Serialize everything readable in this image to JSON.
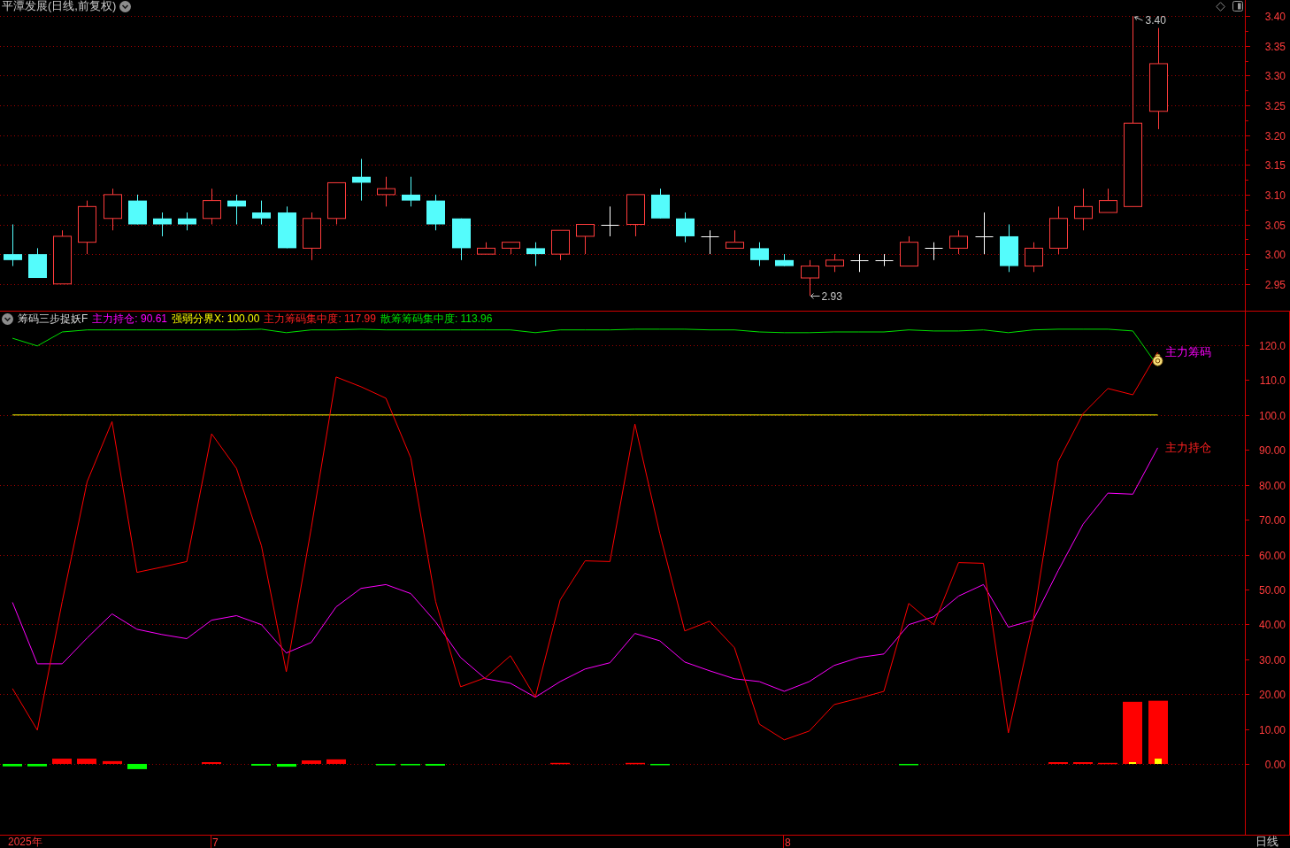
{
  "price_pane": {
    "title": "平潭发展(日线,前复权)",
    "chart_data": {
      "type": "candlestick",
      "categories": [
        null,
        null,
        null,
        null,
        null,
        null,
        null,
        null,
        null,
        null,
        null,
        null,
        null,
        null,
        null,
        null,
        null,
        null,
        null,
        null,
        null,
        null,
        null,
        null,
        null,
        null,
        null,
        null,
        null,
        null,
        null,
        null,
        null,
        null,
        null,
        null,
        null,
        null,
        null,
        null,
        null,
        null,
        null,
        null,
        null,
        null,
        null,
        null,
        null,
        null
      ],
      "ylim": [
        2.905,
        3.427
      ],
      "grid": true,
      "yticks": [
        {
          "value": 3.4,
          "label": "3.40"
        },
        {
          "value": 3.35,
          "label": "3.35"
        },
        {
          "value": 3.3,
          "label": "3.30"
        },
        {
          "value": 3.25,
          "label": "3.25"
        },
        {
          "value": 3.2,
          "label": "3.20"
        },
        {
          "value": 3.15,
          "label": "3.15"
        },
        {
          "value": 3.1,
          "label": "3.10"
        },
        {
          "value": 3.05,
          "label": "3.05"
        },
        {
          "value": 3.0,
          "label": "3.00"
        },
        {
          "value": 2.95,
          "label": "2.95"
        }
      ],
      "ohlc": [
        [
          3.0,
          3.05,
          2.98,
          2.99
        ],
        [
          3.0,
          3.01,
          2.96,
          2.96
        ],
        [
          2.95,
          3.04,
          2.95,
          3.03
        ],
        [
          3.02,
          3.09,
          3.0,
          3.08
        ],
        [
          3.06,
          3.11,
          3.04,
          3.1
        ],
        [
          3.09,
          3.1,
          3.05,
          3.05
        ],
        [
          3.06,
          3.07,
          3.03,
          3.05
        ],
        [
          3.06,
          3.07,
          3.04,
          3.05
        ],
        [
          3.06,
          3.11,
          3.05,
          3.09
        ],
        [
          3.09,
          3.1,
          3.05,
          3.08
        ],
        [
          3.07,
          3.09,
          3.05,
          3.06
        ],
        [
          3.07,
          3.08,
          3.01,
          3.01
        ],
        [
          3.01,
          3.07,
          2.99,
          3.06
        ],
        [
          3.06,
          3.12,
          3.05,
          3.12
        ],
        [
          3.13,
          3.16,
          3.09,
          3.12
        ],
        [
          3.1,
          3.13,
          3.08,
          3.11
        ],
        [
          3.1,
          3.13,
          3.08,
          3.09
        ],
        [
          3.09,
          3.1,
          3.04,
          3.05
        ],
        [
          3.06,
          3.06,
          2.99,
          3.01
        ],
        [
          3.0,
          3.02,
          3.0,
          3.01
        ],
        [
          3.01,
          3.02,
          3.0,
          3.02
        ],
        [
          3.01,
          3.02,
          2.98,
          3.0
        ],
        [
          3.0,
          3.04,
          2.99,
          3.04
        ],
        [
          3.03,
          3.05,
          3.0,
          3.05
        ],
        [
          3.05,
          3.08,
          3.03,
          3.05
        ],
        [
          3.05,
          3.1,
          3.03,
          3.1
        ],
        [
          3.1,
          3.11,
          3.06,
          3.06
        ],
        [
          3.06,
          3.07,
          3.02,
          3.03
        ],
        [
          3.03,
          3.04,
          3.0,
          3.03
        ],
        [
          3.01,
          3.04,
          3.01,
          3.02
        ],
        [
          3.01,
          3.02,
          2.98,
          2.99
        ],
        [
          2.99,
          3.0,
          2.98,
          2.98
        ],
        [
          2.96,
          2.99,
          2.93,
          2.98
        ],
        [
          2.98,
          3.0,
          2.97,
          2.99
        ],
        [
          2.99,
          3.0,
          2.97,
          2.99
        ],
        [
          2.99,
          3.0,
          2.98,
          2.99
        ],
        [
          2.98,
          3.03,
          2.98,
          3.02
        ],
        [
          3.01,
          3.02,
          2.99,
          3.01
        ],
        [
          3.01,
          3.04,
          3.0,
          3.03
        ],
        [
          3.03,
          3.07,
          3.0,
          3.03
        ],
        [
          3.03,
          3.05,
          2.97,
          2.98
        ],
        [
          2.98,
          3.02,
          2.97,
          3.01
        ],
        [
          3.01,
          3.08,
          3.0,
          3.06
        ],
        [
          3.06,
          3.11,
          3.04,
          3.08
        ],
        [
          3.07,
          3.11,
          3.07,
          3.09
        ],
        [
          3.08,
          3.4,
          3.08,
          3.22
        ],
        [
          3.24,
          3.38,
          3.21,
          3.32
        ],
        null,
        null,
        null
      ],
      "annotations": [
        "3.40",
        "2.93"
      ]
    }
  },
  "indicator_pane": {
    "title": "筹码三步捉妖F",
    "legend": [
      {
        "text": "主力持仓: 90.61",
        "color": "#ff00ff"
      },
      {
        "text": "强弱分界X: 100.00",
        "color": "#ffff00"
      },
      {
        "text": "主力筹码集中度: 117.99",
        "color": "#ff2020"
      },
      {
        "text": "散筹筹码集中度: 113.96",
        "color": "#00e000"
      }
    ],
    "line_labels": [
      {
        "text": "主力筹码",
        "color": "#ff00ff"
      },
      {
        "text": "主力持仓",
        "color": "#ff2020"
      }
    ],
    "chart_data": {
      "type": "line",
      "categories": [
        null,
        null,
        null,
        null,
        null,
        null,
        null,
        null,
        "7",
        null,
        null,
        null,
        null,
        null,
        null,
        null,
        null,
        null,
        null,
        null,
        null,
        null,
        null,
        null,
        null,
        null,
        null,
        null,
        null,
        null,
        null,
        "8",
        null,
        null,
        null,
        null,
        null,
        null,
        null,
        null,
        null,
        null,
        null,
        null,
        null,
        null,
        null,
        null,
        null,
        null
      ],
      "ylim": [
        -20.3,
        129.9
      ],
      "grid": true,
      "yticks": [
        {
          "value": 120,
          "label": "120.0"
        },
        {
          "value": 110,
          "label": "110.0"
        },
        {
          "value": 100,
          "label": "100.0"
        },
        {
          "value": 90,
          "label": "90.00"
        },
        {
          "value": 80,
          "label": "80.00"
        },
        {
          "value": 70,
          "label": "70.00"
        },
        {
          "value": 60,
          "label": "60.00"
        },
        {
          "value": 50,
          "label": "50.00"
        },
        {
          "value": 40,
          "label": "40.00"
        },
        {
          "value": 30,
          "label": "30.00"
        },
        {
          "value": 20,
          "label": "20.00"
        },
        {
          "value": 10,
          "label": "10.00"
        },
        {
          "value": 0,
          "label": "0.00"
        }
      ],
      "series": [
        {
          "type": "bar",
          "color": "#ff0000",
          "values": [
            null,
            null,
            1.5,
            1.5,
            0.8,
            null,
            null,
            null,
            0.5,
            null,
            null,
            null,
            1.0,
            1.3,
            null,
            null,
            null,
            null,
            null,
            null,
            null,
            null,
            0.3,
            null,
            null,
            0.3,
            null,
            null,
            null,
            null,
            null,
            null,
            null,
            null,
            null,
            null,
            null,
            null,
            null,
            null,
            null,
            null,
            0.5,
            0.5,
            0.3,
            17.8,
            18.1,
            null,
            null,
            null
          ]
        },
        {
          "type": "bar",
          "color": "#00ff00",
          "values": [
            -0.7,
            -0.7,
            null,
            null,
            null,
            -1.5,
            null,
            null,
            null,
            null,
            -0.5,
            -0.8,
            null,
            null,
            null,
            -0.4,
            -0.4,
            -0.5,
            null,
            null,
            null,
            null,
            null,
            null,
            null,
            null,
            -0.3,
            null,
            null,
            null,
            null,
            null,
            null,
            null,
            null,
            null,
            -0.3,
            null,
            null,
            null,
            null,
            null,
            null,
            null,
            null,
            null,
            null,
            null,
            null,
            null
          ]
        },
        {
          "type": "bar",
          "color": "#ffff00",
          "values": [
            null,
            null,
            null,
            null,
            null,
            null,
            null,
            null,
            null,
            null,
            null,
            null,
            null,
            null,
            null,
            null,
            null,
            null,
            null,
            null,
            null,
            null,
            null,
            null,
            null,
            null,
            null,
            null,
            null,
            null,
            null,
            null,
            null,
            null,
            null,
            null,
            null,
            null,
            null,
            null,
            null,
            null,
            null,
            null,
            null,
            0.5,
            1.5,
            null,
            null,
            null
          ]
        },
        {
          "type": "line",
          "color": "#ff00ff",
          "values": [
            46.3,
            28.7,
            28.7,
            36.1,
            43.0,
            38.6,
            37.1,
            35.9,
            41.2,
            42.5,
            39.9,
            31.8,
            34.8,
            45.0,
            50.3,
            51.4,
            48.8,
            40.7,
            30.5,
            24.4,
            23.1,
            19.1,
            23.6,
            27.2,
            29.0,
            37.4,
            35.3,
            29.2,
            26.7,
            24.4,
            23.6,
            20.8,
            23.6,
            28.2,
            30.5,
            31.5,
            39.9,
            42.2,
            48.1,
            51.4,
            39.2,
            41.2,
            55.4,
            68.7,
            77.6,
            77.3,
            90.6,
            null,
            null,
            null
          ]
        },
        {
          "type": "line",
          "color": "#ffff00",
          "values": [
            100,
            100,
            100,
            100,
            100,
            100,
            100,
            100,
            100,
            100,
            100,
            100,
            100,
            100,
            100,
            100,
            100,
            100,
            100,
            100,
            100,
            100,
            100,
            100,
            100,
            100,
            100,
            100,
            100,
            100,
            100,
            100,
            100,
            100,
            100,
            100,
            100,
            100,
            100,
            100,
            100,
            100,
            100,
            100,
            100,
            100,
            100,
            null,
            null,
            null
          ]
        },
        {
          "type": "line",
          "color": "#ff0000",
          "values": [
            21.6,
            9.7,
            46.5,
            80.9,
            98.1,
            54.9,
            56.4,
            58.0,
            94.6,
            84.7,
            62.5,
            26.4,
            67.6,
            110.9,
            108.1,
            104.8,
            87.7,
            46.5,
            22.1,
            24.7,
            31.0,
            19.1,
            47.0,
            58.2,
            58.0,
            97.4,
            66.1,
            38.1,
            40.9,
            33.3,
            11.4,
            6.9,
            9.4,
            17.0,
            18.8,
            20.8,
            46.0,
            39.9,
            57.7,
            57.5,
            8.9,
            41.2,
            86.7,
            100.4,
            107.6,
            105.8,
            118.0,
            null,
            null,
            null
          ]
        },
        {
          "type": "line",
          "color": "#00e000",
          "values": [
            122.0,
            119.8,
            123.8,
            124.4,
            124.4,
            124.4,
            124.4,
            124.4,
            124.4,
            124.4,
            124.6,
            123.6,
            124.4,
            124.4,
            124.6,
            124.4,
            124.4,
            124.4,
            124.4,
            124.4,
            124.4,
            123.6,
            124.4,
            124.4,
            124.4,
            124.6,
            124.6,
            124.6,
            124.4,
            124.4,
            123.8,
            123.6,
            123.6,
            123.8,
            123.8,
            123.8,
            124.4,
            124.1,
            124.1,
            124.4,
            123.6,
            124.4,
            124.6,
            124.6,
            124.6,
            124.1,
            114.0,
            null,
            null,
            null
          ]
        }
      ]
    }
  },
  "time_axis": {
    "year": "2025年",
    "period": "日线"
  }
}
